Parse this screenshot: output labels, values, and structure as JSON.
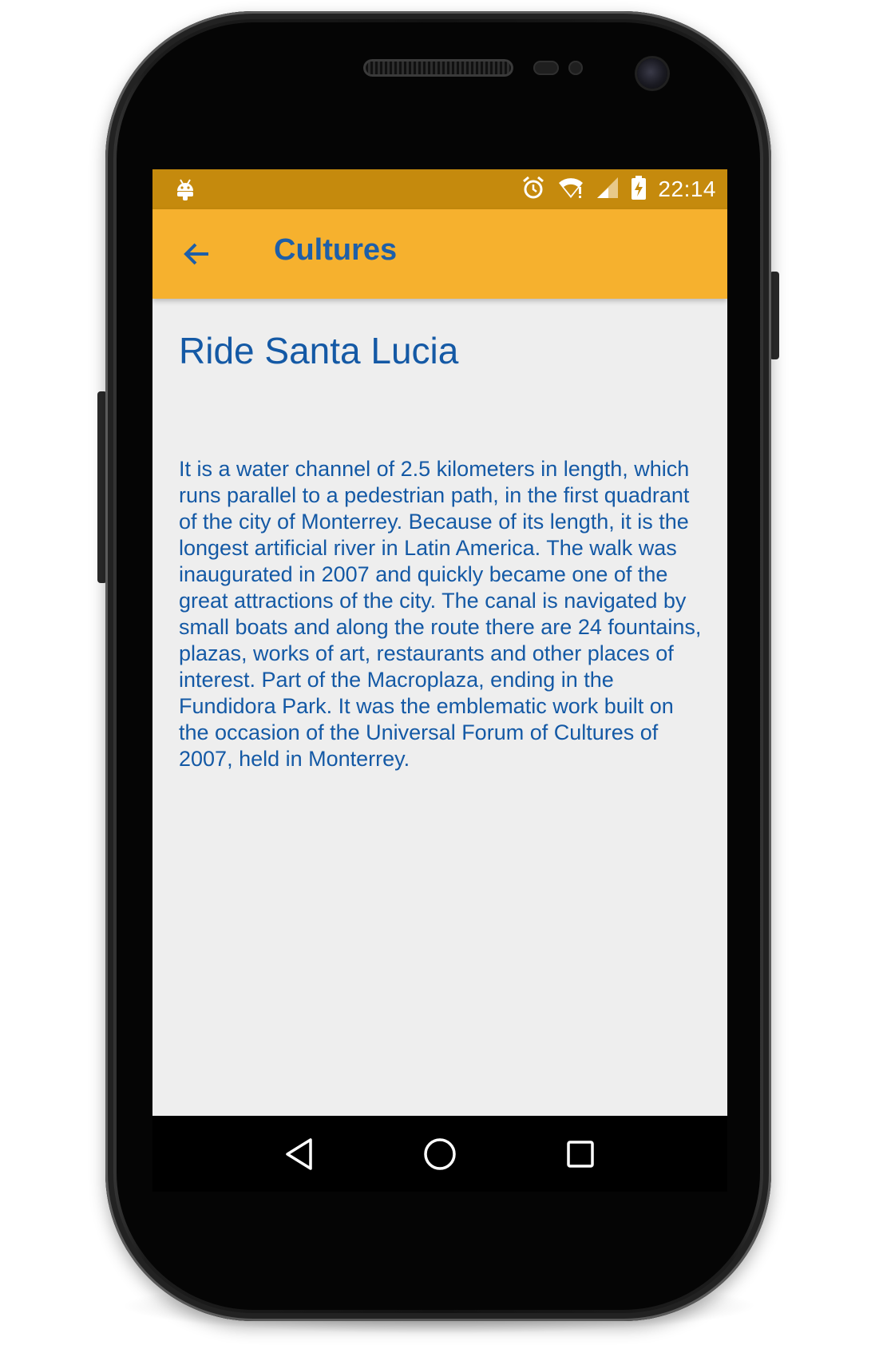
{
  "status_bar": {
    "notification_icon": "android-icon",
    "icons": [
      "alarm-icon",
      "wifi-icon",
      "signal-icon",
      "battery-charging-icon"
    ],
    "time": "22:14"
  },
  "app_bar": {
    "back_icon": "arrow-back-icon",
    "title": "Cultures",
    "background_color": "#f6b12e",
    "title_color": "#1e5fa8"
  },
  "content": {
    "heading": "Ride Santa Lucia",
    "body": "It is a water channel of 2.5 kilometers in length, which runs parallel to a pedestrian path, in the first quadrant of the city of Monterrey. Because of its length, it is the longest artificial river in Latin America. The walk was inaugurated in 2007 and quickly became one of the great attractions of the city. The canal is navigated by small boats and along the route there are 24 fountains, plazas, works of art, restaurants and other places of interest. Part of the Macroplaza, ending in the Fundidora Park. It was the emblematic work built on the occasion of the Universal Forum of Cultures of 2007, held in Monterrey.",
    "text_color": "#1459a5"
  },
  "nav_bar": {
    "buttons": [
      "back-triangle-icon",
      "home-circle-icon",
      "recents-square-icon"
    ]
  }
}
